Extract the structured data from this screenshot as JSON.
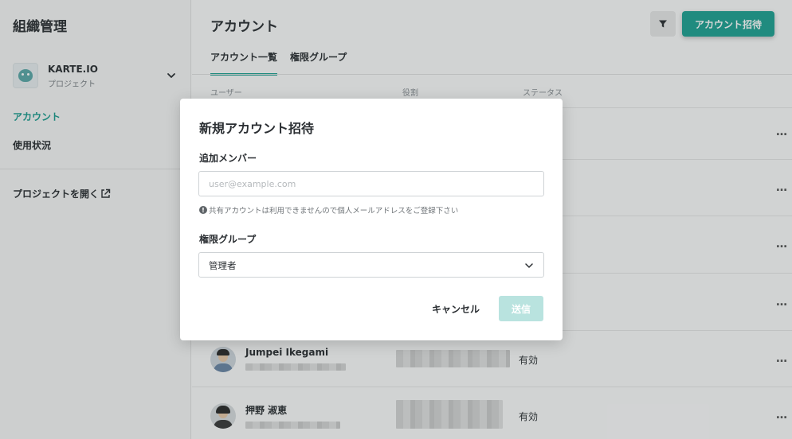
{
  "sidebar": {
    "org_title": "組織管理",
    "project_name": "KARTE.IO",
    "project_sub": "プロジェクト",
    "nav": [
      {
        "label": "アカウント",
        "active": true
      },
      {
        "label": "使用状況",
        "active": false
      }
    ],
    "open_project": "プロジェクトを開く"
  },
  "header": {
    "title": "アカウント",
    "invite_button": "アカウント招待"
  },
  "tabs": [
    {
      "label": "アカウント一覧",
      "active": true
    },
    {
      "label": "権限グループ",
      "active": false
    }
  ],
  "table": {
    "columns": [
      "ユーザー",
      "役割",
      "ステータス"
    ],
    "rows": [
      {
        "name": "Jumpei Ikegami",
        "status": "有効"
      },
      {
        "name": "押野 淑恵",
        "status": "有効"
      }
    ],
    "more_label": "…"
  },
  "modal": {
    "title": "新規アカウント招待",
    "member_label": "追加メンバー",
    "email_placeholder": "user@example.com",
    "email_value": "",
    "hint": "共有アカウントは利用できませんので個人メールアドレスをご登録下さい",
    "group_label": "権限グループ",
    "group_value": "管理者",
    "cancel": "キャンセル",
    "send": "送信"
  },
  "colors": {
    "accent": "#1ea293",
    "accent_disabled": "#b9e3df",
    "active_nav": "#1b9b8e"
  }
}
